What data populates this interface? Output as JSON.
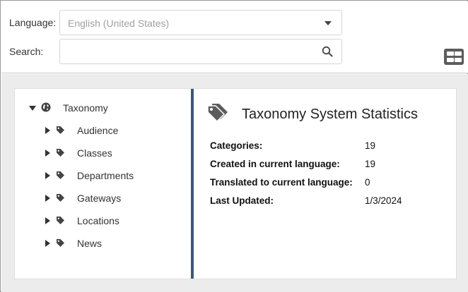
{
  "filters": {
    "language_label": "Language:",
    "language_value": "English (United States)",
    "search_label": "Search:",
    "search_value": "",
    "search_placeholder": ""
  },
  "toolbar": {
    "view_toggle_icon": "grid-icon"
  },
  "tree": {
    "root": {
      "label": "Taxonomy",
      "icon": "globe-icon",
      "expanded": true
    },
    "items": [
      {
        "label": "Audience",
        "icon": "tag-icon",
        "expanded": false
      },
      {
        "label": "Classes",
        "icon": "tag-icon",
        "expanded": false
      },
      {
        "label": "Departments",
        "icon": "tag-icon",
        "expanded": false
      },
      {
        "label": "Gateways",
        "icon": "tag-icon",
        "expanded": false
      },
      {
        "label": "Locations",
        "icon": "tag-icon",
        "expanded": false
      },
      {
        "label": "News",
        "icon": "tag-icon",
        "expanded": false
      }
    ]
  },
  "stats": {
    "title": "Taxonomy System Statistics",
    "icon": "tags-icon",
    "rows": [
      {
        "label": "Categories:",
        "value": "19"
      },
      {
        "label": "Created in current language:",
        "value": "19"
      },
      {
        "label": "Translated to current language:",
        "value": "0"
      },
      {
        "label": "Last Updated:",
        "value": "1/3/2024"
      }
    ]
  },
  "colors": {
    "splitter": "#39587a",
    "content_background": "#ececec",
    "view_toggle_button": "#5c5c5c"
  }
}
